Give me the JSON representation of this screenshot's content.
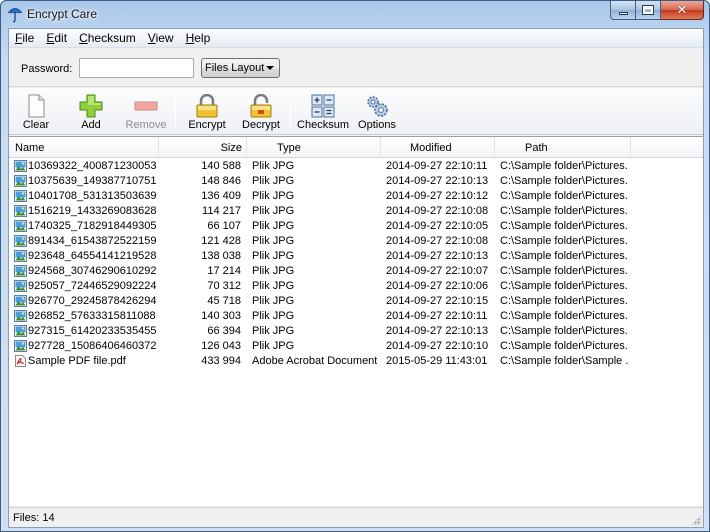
{
  "window": {
    "title": "Encrypt Care"
  },
  "menu": [
    {
      "accel": "F",
      "rest": "ile"
    },
    {
      "accel": "E",
      "rest": "dit"
    },
    {
      "accel": "C",
      "rest": "hecksum"
    },
    {
      "accel": "V",
      "rest": "iew"
    },
    {
      "accel": "H",
      "rest": "elp"
    }
  ],
  "password": {
    "label": "Password:",
    "value": "",
    "layout_selected": "Files Layout"
  },
  "toolbar": {
    "clear": "Clear",
    "add": "Add",
    "remove": "Remove",
    "encrypt": "Encrypt",
    "decrypt": "Decrypt",
    "checksum": "Checksum",
    "options": "Options"
  },
  "columns": {
    "name": "Name",
    "size": "Size",
    "type": "Type",
    "modified": "Modified",
    "path": "Path"
  },
  "files": [
    {
      "icon": "image-file-icon",
      "name": "10369322_400871230053...",
      "size": "140 588",
      "type": "Plik JPG",
      "modified": "2014-09-27 22:10:11",
      "path": "C:\\Sample folder\\Pictures..."
    },
    {
      "icon": "image-file-icon",
      "name": "10375639_149387710751...",
      "size": "148 846",
      "type": "Plik JPG",
      "modified": "2014-09-27 22:10:13",
      "path": "C:\\Sample folder\\Pictures..."
    },
    {
      "icon": "image-file-icon",
      "name": "10401708_531313503639...",
      "size": "136 409",
      "type": "Plik JPG",
      "modified": "2014-09-27 22:10:12",
      "path": "C:\\Sample folder\\Pictures..."
    },
    {
      "icon": "image-file-icon",
      "name": "1516219_1433269083628...",
      "size": "114 217",
      "type": "Plik JPG",
      "modified": "2014-09-27 22:10:08",
      "path": "C:\\Sample folder\\Pictures..."
    },
    {
      "icon": "image-file-icon",
      "name": "1740325_7182918449305...",
      "size": "66 107",
      "type": "Plik JPG",
      "modified": "2014-09-27 22:10:05",
      "path": "C:\\Sample folder\\Pictures..."
    },
    {
      "icon": "image-file-icon",
      "name": "891434_61543872522159...",
      "size": "121 428",
      "type": "Plik JPG",
      "modified": "2014-09-27 22:10:08",
      "path": "C:\\Sample folder\\Pictures..."
    },
    {
      "icon": "image-file-icon",
      "name": "923648_64554141219528...",
      "size": "138 038",
      "type": "Plik JPG",
      "modified": "2014-09-27 22:10:13",
      "path": "C:\\Sample folder\\Pictures..."
    },
    {
      "icon": "image-file-icon",
      "name": "924568_30746290610292...",
      "size": "17 214",
      "type": "Plik JPG",
      "modified": "2014-09-27 22:10:07",
      "path": "C:\\Sample folder\\Pictures..."
    },
    {
      "icon": "image-file-icon",
      "name": "925057_72446529092224...",
      "size": "70 312",
      "type": "Plik JPG",
      "modified": "2014-09-27 22:10:06",
      "path": "C:\\Sample folder\\Pictures..."
    },
    {
      "icon": "image-file-icon",
      "name": "926770_29245878426294...",
      "size": "45 718",
      "type": "Plik JPG",
      "modified": "2014-09-27 22:10:15",
      "path": "C:\\Sample folder\\Pictures..."
    },
    {
      "icon": "image-file-icon",
      "name": "926852_57633315811088...",
      "size": "140 303",
      "type": "Plik JPG",
      "modified": "2014-09-27 22:10:11",
      "path": "C:\\Sample folder\\Pictures..."
    },
    {
      "icon": "image-file-icon",
      "name": "927315_61420233535455...",
      "size": "66 394",
      "type": "Plik JPG",
      "modified": "2014-09-27 22:10:13",
      "path": "C:\\Sample folder\\Pictures..."
    },
    {
      "icon": "image-file-icon",
      "name": "927728_15086406460372...",
      "size": "126 043",
      "type": "Plik JPG",
      "modified": "2014-09-27 22:10:10",
      "path": "C:\\Sample folder\\Pictures..."
    },
    {
      "icon": "pdf-file-icon",
      "name": "Sample PDF file.pdf",
      "size": "433 994",
      "type": "Adobe Acrobat Document",
      "modified": "2015-05-29 11:43:01",
      "path": "C:\\Sample folder\\Sample ..."
    }
  ],
  "status": {
    "files": "Files: 14"
  }
}
